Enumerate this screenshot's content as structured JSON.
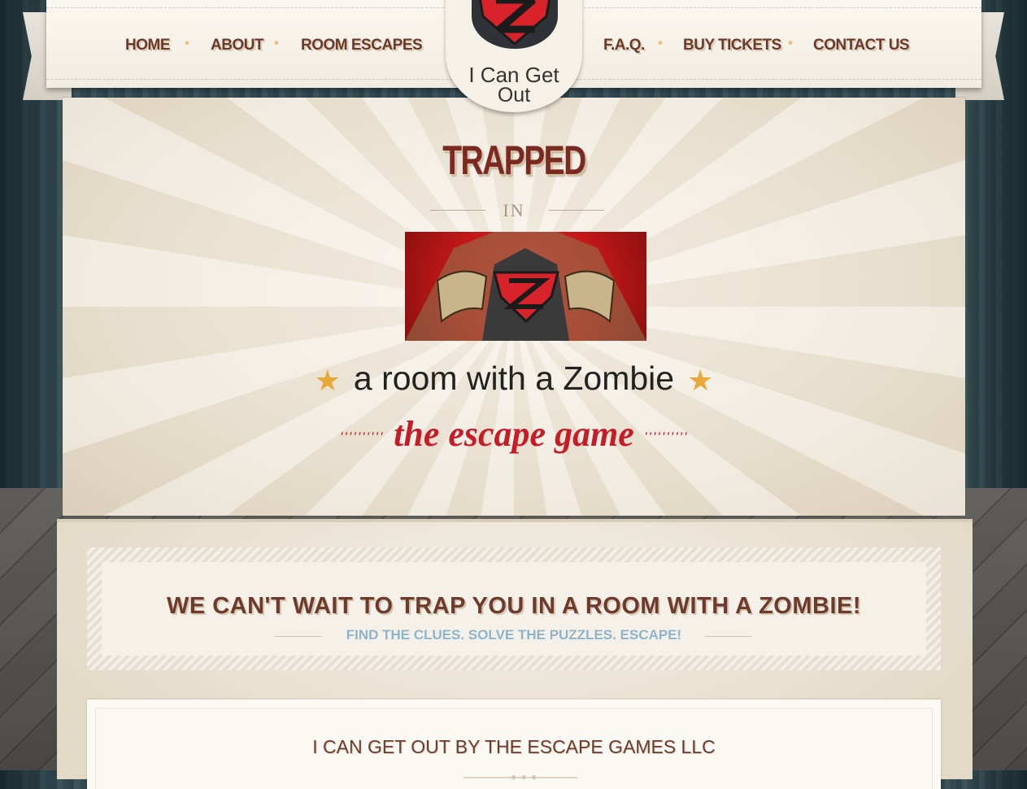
{
  "nav": {
    "items": [
      {
        "label": "HOME"
      },
      {
        "label": "ABOUT"
      },
      {
        "label": "ROOM ESCAPES"
      },
      {
        "label": "F.A.Q."
      },
      {
        "label": "BUY TICKETS"
      },
      {
        "label": "CONTACT US"
      }
    ],
    "separator": "*"
  },
  "logo": {
    "line1": "I Can Get",
    "line2": "Out"
  },
  "hero": {
    "headline": "TRAPPED",
    "connector": "IN",
    "tagline": "a room with a Zombie",
    "subtitle": "the escape game",
    "star_icon": "★",
    "dots": "''''''''''"
  },
  "banner": {
    "title": "WE CAN'T WAIT TO TRAP YOU IN A ROOM WITH A ZOMBIE!",
    "subtitle": "FIND THE CLUES. SOLVE THE PUZZLES. ESCAPE!"
  },
  "card": {
    "title": "I CAN GET OUT BY THE ESCAPE GAMES LLC",
    "ornament": "● ● ●"
  },
  "colors": {
    "accent_red": "#c41d27",
    "nav_brown": "#6a3a2c",
    "subtitle_blue": "#8fb2c6",
    "star_gold": "#e5a43a"
  }
}
